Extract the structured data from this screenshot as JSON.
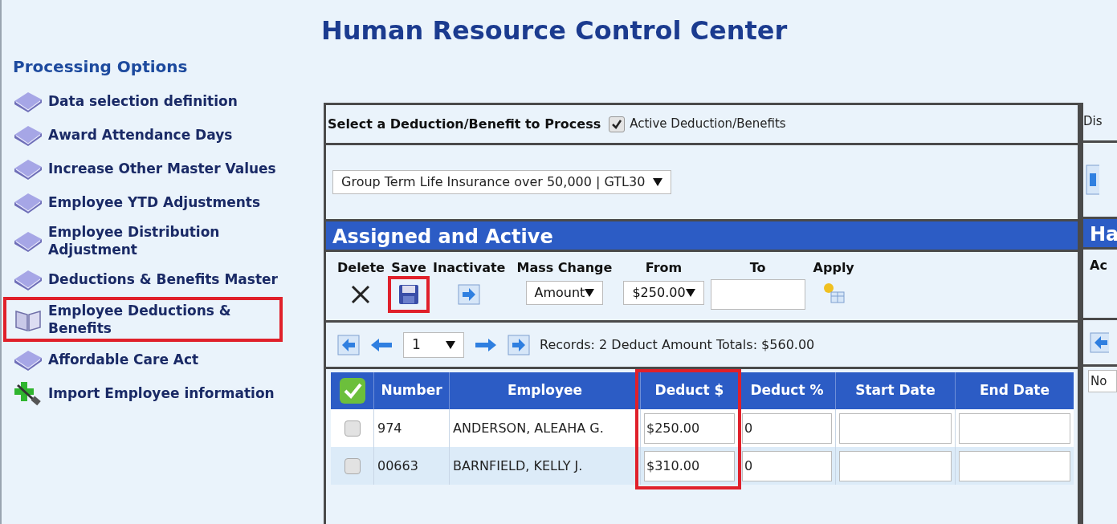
{
  "title": "Human Resource Control Center",
  "sidebar": {
    "heading": "Processing Options",
    "items": [
      {
        "label": "Data selection definition",
        "kind": "book",
        "highlighted": false
      },
      {
        "label": "Award Attendance Days",
        "kind": "book",
        "highlighted": false
      },
      {
        "label": "Increase Other Master Values",
        "kind": "book",
        "highlighted": false
      },
      {
        "label": "Employee YTD Adjustments",
        "kind": "book",
        "highlighted": false
      },
      {
        "label": "Employee Distribution Adjustment",
        "kind": "book",
        "highlighted": false
      },
      {
        "label": "Deductions & Benefits Master",
        "kind": "book",
        "highlighted": false
      },
      {
        "label": "Employee Deductions & Benefits",
        "kind": "open-book",
        "highlighted": true
      },
      {
        "label": "Affordable Care Act",
        "kind": "book",
        "highlighted": false
      },
      {
        "label": "Import Employee information",
        "kind": "import",
        "highlighted": false
      }
    ]
  },
  "selector": {
    "heading": "Select a Deduction/Benefit to Process",
    "active_filter": {
      "label": "Active Deduction/Benefits",
      "checked": true
    },
    "value": "Group Term Life Insurance over 50,000 | GTL30"
  },
  "assigned": {
    "title": "Assigned and Active",
    "actions": [
      {
        "label": "Delete",
        "kind": "delete",
        "highlighted": false
      },
      {
        "label": "Save",
        "kind": "save",
        "highlighted": true
      },
      {
        "label": "Inactivate",
        "kind": "inactivate",
        "highlighted": false
      }
    ],
    "mass_change": {
      "label": "Mass Change",
      "value": "Amount"
    },
    "from": {
      "label": "From",
      "value": "$250.00"
    },
    "to": {
      "label": "To"
    },
    "apply": {
      "label": "Apply"
    },
    "pager": {
      "page": "1",
      "summary": "Records: 2 Deduct Amount Totals: $560.00"
    },
    "table": {
      "columns": [
        {
          "label": "Number",
          "highlighted": false
        },
        {
          "label": "Employee",
          "highlighted": false
        },
        {
          "label": "Deduct $",
          "highlighted": true
        },
        {
          "label": "Deduct %",
          "highlighted": false
        },
        {
          "label": "Start Date",
          "highlighted": false
        },
        {
          "label": "End Date",
          "highlighted": false
        }
      ],
      "rows": [
        {
          "checked": false,
          "cells": [
            "974",
            "ANDERSON, ALEAHA G.",
            "$250.00",
            "0"
          ]
        },
        {
          "checked": false,
          "cells": [
            "00663",
            "BARNFIELD, KELLY J.",
            "$310.00",
            "0"
          ]
        }
      ]
    }
  },
  "side_panel": {
    "header_text": "Dis",
    "title": "Ha",
    "toolbar_text": "Ac",
    "field_value": "No"
  }
}
